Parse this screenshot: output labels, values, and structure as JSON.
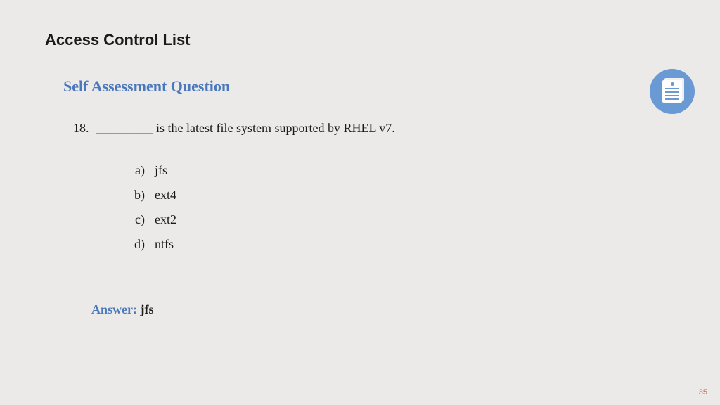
{
  "title": "Access Control List",
  "subhead": "Self Assessment Question",
  "question": {
    "number": "18.",
    "text": "_________ is the latest file system supported by RHEL v7."
  },
  "options": [
    {
      "letter": "a)",
      "text": "jfs"
    },
    {
      "letter": "b)",
      "text": "ext4"
    },
    {
      "letter": "c)",
      "text": "ext2"
    },
    {
      "letter": "d)",
      "text": "ntfs"
    }
  ],
  "answer": {
    "label": "Answer: ",
    "value": "jfs"
  },
  "page_number": "35"
}
